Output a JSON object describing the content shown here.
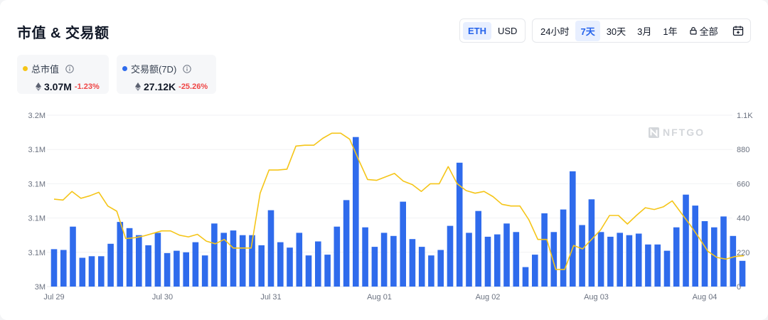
{
  "title": "市值 & 交易额",
  "currency_toggle": [
    {
      "label": "ETH",
      "active": true
    },
    {
      "label": "USD",
      "active": false
    }
  ],
  "range_toggle": [
    {
      "label": "24小时",
      "active": false
    },
    {
      "label": "7天",
      "active": true
    },
    {
      "label": "30天",
      "active": false
    },
    {
      "label": "3月",
      "active": false
    },
    {
      "label": "1年",
      "active": false
    },
    {
      "label": "全部",
      "active": false,
      "icon": "lock-icon"
    }
  ],
  "metrics": [
    {
      "label": "总市值",
      "value": "3.07M",
      "change": "-1.23%",
      "dot_color": "#f5c518"
    },
    {
      "label": "交易额(7D)",
      "value": "27.12K",
      "change": "-25.26%",
      "dot_color": "#2f6bec"
    }
  ],
  "watermark": "NFTGO",
  "colors": {
    "bar": "#2f6bec",
    "line": "#f5c518",
    "negative": "#ef4444",
    "active": "#2563eb"
  },
  "chart_data": {
    "type": "bar+line",
    "x_labels": [
      "Jul 29",
      "Jul 30",
      "Jul 31",
      "Aug 01",
      "Aug 02",
      "Aug 03",
      "Aug 04"
    ],
    "left_axis": {
      "ticks": [
        "3M",
        "3.1M",
        "3.1M",
        "3.1M",
        "3.1M",
        "3.2M"
      ],
      "series": "总市值"
    },
    "right_axis": {
      "ticks": [
        "0",
        "220",
        "440",
        "660",
        "880",
        "1.1K"
      ],
      "range": [
        0,
        1100
      ],
      "series": "交易额(7D)"
    },
    "series": [
      {
        "name": "交易额(7D)",
        "type": "bar",
        "values": [
          240,
          235,
          385,
          185,
          195,
          195,
          275,
          415,
          375,
          330,
          265,
          345,
          215,
          230,
          220,
          285,
          200,
          405,
          345,
          360,
          330,
          330,
          265,
          490,
          285,
          250,
          345,
          200,
          290,
          205,
          385,
          555,
          960,
          380,
          255,
          345,
          325,
          545,
          305,
          255,
          200,
          235,
          390,
          795,
          345,
          485,
          320,
          335,
          405,
          350,
          125,
          205,
          470,
          350,
          495,
          740,
          395,
          560,
          350,
          320,
          345,
          330,
          340,
          270,
          270,
          230,
          380,
          590,
          520,
          420,
          380,
          450,
          325,
          165
        ],
        "x_positions": [
          0.0,
          0.2,
          0.4,
          0.6,
          0.8,
          1.0,
          1.2,
          1.4,
          1.6,
          1.8,
          2.0,
          2.2,
          2.4,
          2.6,
          2.8,
          3.0,
          3.2,
          3.4,
          3.6,
          3.8,
          4.0,
          4.2,
          4.4,
          4.6,
          4.8,
          5.0,
          5.2,
          5.4,
          5.6,
          5.8,
          6.0,
          6.2,
          6.4,
          6.6,
          6.8,
          7.0,
          7.2,
          7.4,
          7.6,
          7.8,
          8.0,
          8.2,
          8.4,
          8.6,
          8.8,
          9.0,
          9.2,
          9.4,
          9.6,
          9.8,
          10.0,
          10.2,
          10.4,
          10.6,
          10.8,
          11.0,
          11.2,
          11.4,
          11.6,
          11.8,
          12.0,
          12.2,
          12.4,
          12.6,
          12.8,
          13.0,
          13.2,
          13.4,
          13.6,
          13.8,
          14.0,
          14.2,
          14.4,
          14.6
        ]
      },
      {
        "name": "总市值",
        "type": "line",
        "values": [
          0.51,
          0.505,
          0.555,
          0.515,
          0.53,
          0.55,
          0.47,
          0.44,
          0.28,
          0.285,
          0.295,
          0.31,
          0.325,
          0.325,
          0.3,
          0.29,
          0.305,
          0.265,
          0.25,
          0.275,
          0.225,
          0.225,
          0.225,
          0.545,
          0.68,
          0.68,
          0.685,
          0.82,
          0.825,
          0.825,
          0.865,
          0.895,
          0.895,
          0.86,
          0.74,
          0.625,
          0.62,
          0.64,
          0.66,
          0.615,
          0.595,
          0.555,
          0.6,
          0.6,
          0.7,
          0.6,
          0.56,
          0.545,
          0.555,
          0.525,
          0.48,
          0.47,
          0.47,
          0.39,
          0.275,
          0.275,
          0.1,
          0.1,
          0.24,
          0.22,
          0.275,
          0.33,
          0.415,
          0.415,
          0.365,
          0.415,
          0.46,
          0.45,
          0.465,
          0.5,
          0.43,
          0.36,
          0.285,
          0.205,
          0.17,
          0.16,
          0.175,
          0.18
        ],
        "x_positions": [
          0.0,
          0.19,
          0.38,
          0.57,
          0.76,
          0.95,
          1.14,
          1.33,
          1.52,
          1.71,
          1.9,
          2.09,
          2.28,
          2.47,
          2.66,
          2.85,
          3.04,
          3.23,
          3.42,
          3.61,
          3.8,
          3.99,
          4.18,
          4.37,
          4.56,
          4.75,
          4.94,
          5.13,
          5.32,
          5.51,
          5.7,
          5.89,
          6.08,
          6.27,
          6.46,
          6.65,
          6.84,
          7.03,
          7.22,
          7.41,
          7.6,
          7.79,
          7.98,
          8.17,
          8.36,
          8.55,
          8.74,
          8.93,
          9.12,
          9.31,
          9.5,
          9.69,
          9.88,
          10.07,
          10.26,
          10.45,
          10.64,
          10.83,
          11.02,
          11.21,
          11.4,
          11.59,
          11.78,
          11.97,
          12.16,
          12.35,
          12.54,
          12.73,
          12.92,
          13.11,
          13.3,
          13.49,
          13.68,
          13.87,
          14.06,
          14.25,
          14.44,
          14.63
        ],
        "value_unit": "fraction of left axis range 3M–3.2M"
      }
    ]
  }
}
